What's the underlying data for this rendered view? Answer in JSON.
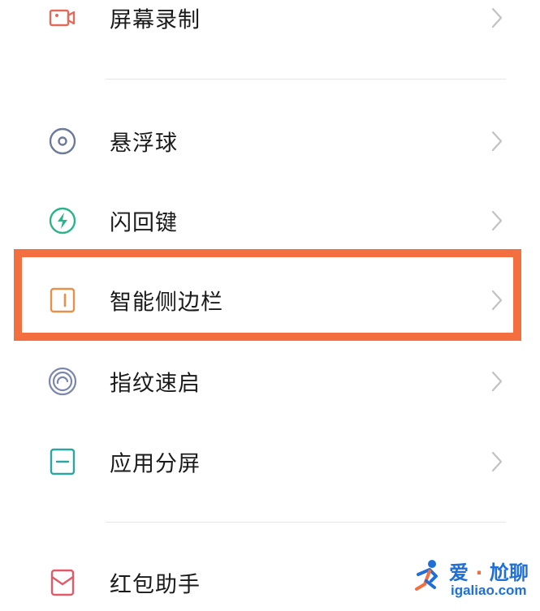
{
  "colors": {
    "highlight": "#f36f3f",
    "divider": "#e6e6e6",
    "chevron": "#c2c2c2"
  },
  "settings_items": [
    {
      "label": "屏幕录制",
      "icon": "screen-record-icon",
      "color": "#e26a5a"
    },
    {
      "label": "悬浮球",
      "icon": "floating-ball-icon",
      "color": "#6b7a99"
    },
    {
      "label": "闪回键",
      "icon": "flashback-key-icon",
      "color": "#2bb38a"
    },
    {
      "label": "智能侧边栏",
      "icon": "smart-sidebar-icon",
      "color": "#e6914a"
    },
    {
      "label": "指纹速启",
      "icon": "fingerprint-icon",
      "color": "#7a86ad"
    },
    {
      "label": "应用分屏",
      "icon": "split-screen-icon",
      "color": "#2ba6a0"
    },
    {
      "label": "红包助手",
      "icon": "red-envelope-icon",
      "color": "#e05a6a"
    }
  ],
  "highlighted_item": "智能侧边栏",
  "watermark": {
    "brand_left": "爱",
    "separator": "·",
    "brand_right": "尬聊",
    "url": "igaliao.com"
  }
}
